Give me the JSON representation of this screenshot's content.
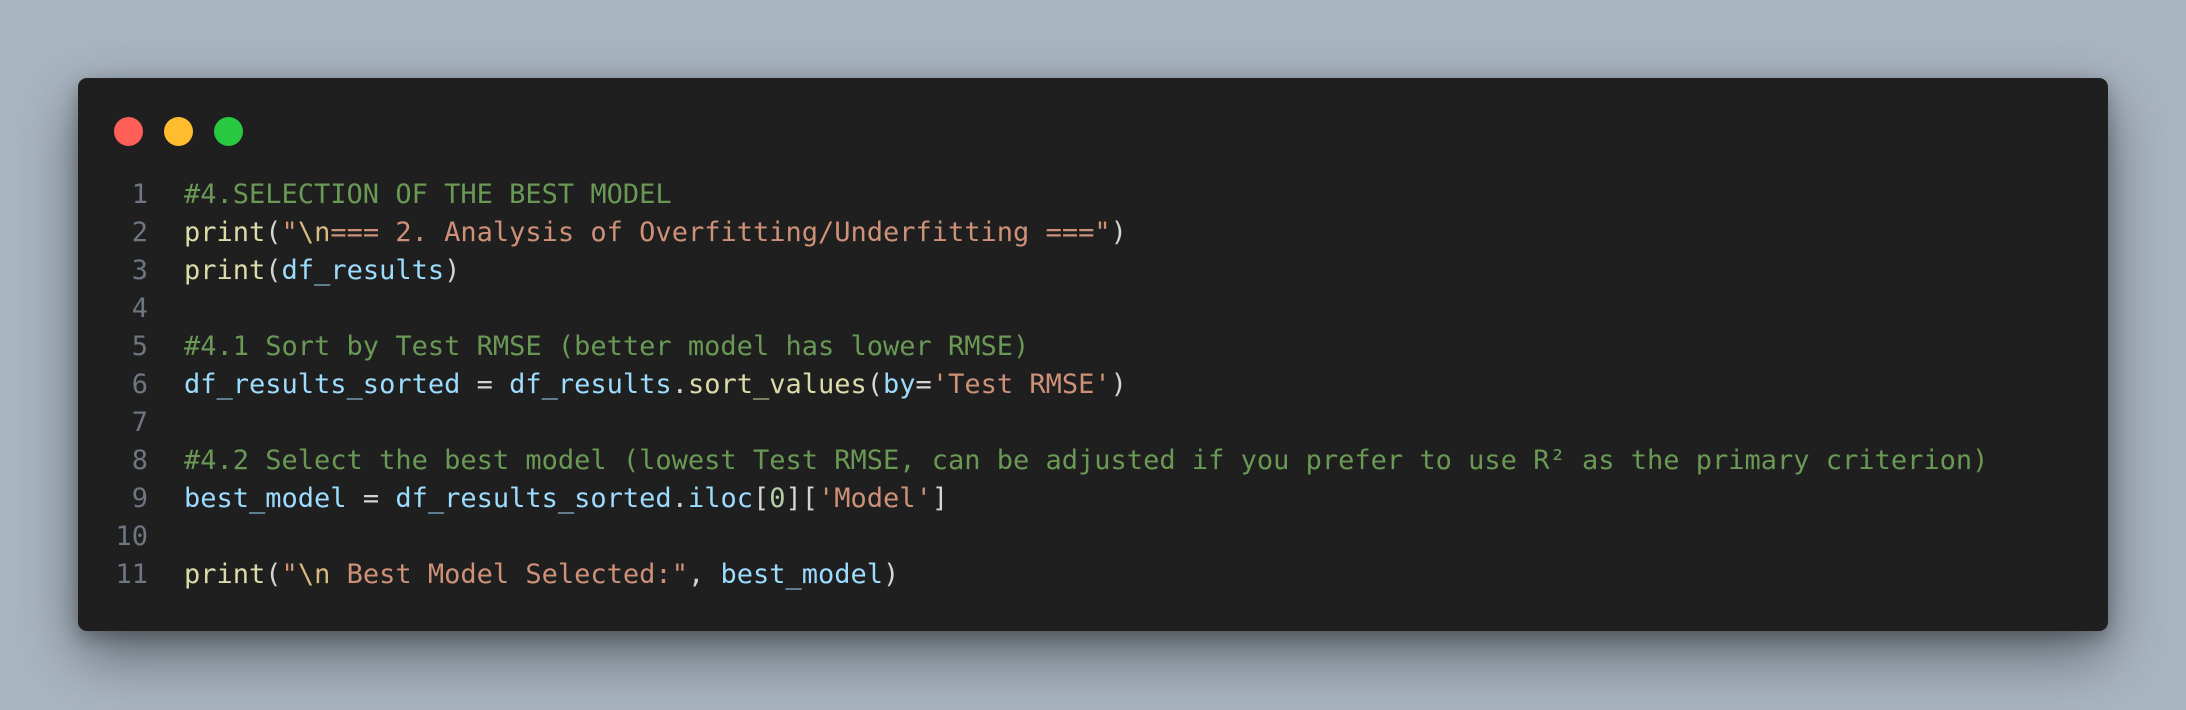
{
  "window": {
    "controls": [
      {
        "name": "close",
        "color": "#ff5f57"
      },
      {
        "name": "minimize",
        "color": "#febc2e"
      },
      {
        "name": "maximize",
        "color": "#28c840"
      }
    ]
  },
  "colors": {
    "page_background": "#a9b5c1",
    "editor_background": "#1f1f1f",
    "comment": "#6a9955",
    "function": "#dcdcaa",
    "string": "#ce9178",
    "escape": "#d7ba7d",
    "variable": "#9cdcfe",
    "punctuation": "#d4d4d4",
    "line_number": "#6e7681"
  },
  "code": {
    "lines": [
      {
        "number": "1",
        "tokens": [
          {
            "t": "comment",
            "text": "#4.SELECTION OF THE BEST MODEL"
          }
        ]
      },
      {
        "number": "2",
        "tokens": [
          {
            "t": "func",
            "text": "print"
          },
          {
            "t": "punct",
            "text": "("
          },
          {
            "t": "string",
            "text": "\""
          },
          {
            "t": "escape",
            "text": "\\n"
          },
          {
            "t": "string",
            "text": "=== 2. Analysis of Overfitting/Underfitting ===\""
          },
          {
            "t": "punct",
            "text": ")"
          }
        ]
      },
      {
        "number": "3",
        "tokens": [
          {
            "t": "func",
            "text": "print"
          },
          {
            "t": "punct",
            "text": "("
          },
          {
            "t": "var",
            "text": "df_results"
          },
          {
            "t": "punct",
            "text": ")"
          }
        ]
      },
      {
        "number": "4",
        "tokens": []
      },
      {
        "number": "5",
        "tokens": [
          {
            "t": "comment",
            "text": "#4.1 Sort by Test RMSE (better model has lower RMSE)"
          }
        ]
      },
      {
        "number": "6",
        "tokens": [
          {
            "t": "var",
            "text": "df_results_sorted"
          },
          {
            "t": "op",
            "text": " = "
          },
          {
            "t": "var",
            "text": "df_results"
          },
          {
            "t": "punct",
            "text": "."
          },
          {
            "t": "func",
            "text": "sort_values"
          },
          {
            "t": "punct",
            "text": "("
          },
          {
            "t": "var",
            "text": "by"
          },
          {
            "t": "op",
            "text": "="
          },
          {
            "t": "string",
            "text": "'Test RMSE'"
          },
          {
            "t": "punct",
            "text": ")"
          }
        ]
      },
      {
        "number": "7",
        "tokens": []
      },
      {
        "number": "8",
        "tokens": [
          {
            "t": "comment",
            "text": "#4.2 Select the best model (lowest Test RMSE, can be adjusted if you prefer to use R² as the primary criterion)"
          }
        ]
      },
      {
        "number": "9",
        "tokens": [
          {
            "t": "var",
            "text": "best_model"
          },
          {
            "t": "op",
            "text": " = "
          },
          {
            "t": "var",
            "text": "df_results_sorted"
          },
          {
            "t": "punct",
            "text": "."
          },
          {
            "t": "var",
            "text": "iloc"
          },
          {
            "t": "punct",
            "text": "["
          },
          {
            "t": "number",
            "text": "0"
          },
          {
            "t": "punct",
            "text": "]["
          },
          {
            "t": "string",
            "text": "'Model'"
          },
          {
            "t": "punct",
            "text": "]"
          }
        ]
      },
      {
        "number": "10",
        "tokens": []
      },
      {
        "number": "11",
        "tokens": [
          {
            "t": "func",
            "text": "print"
          },
          {
            "t": "punct",
            "text": "("
          },
          {
            "t": "string",
            "text": "\""
          },
          {
            "t": "escape",
            "text": "\\n"
          },
          {
            "t": "string",
            "text": " Best Model Selected:\""
          },
          {
            "t": "punct",
            "text": ", "
          },
          {
            "t": "var",
            "text": "best_model"
          },
          {
            "t": "punct",
            "text": ")"
          }
        ]
      }
    ]
  }
}
